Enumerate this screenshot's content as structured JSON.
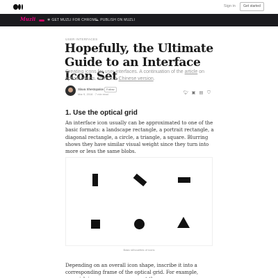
{
  "nav": {
    "logo_icon": "medium-logo-icon",
    "sign_in": "Sign in",
    "get_started": "Get started"
  },
  "banner": {
    "brand": "Muzli",
    "chrome_icon": "chrome-icon",
    "chrome_label": "GET MUZLI FOR CHROME",
    "publish_icon": "publish-icon",
    "publish_label": "PUBLISH ON MUZLI",
    "accent": "#e6007e"
  },
  "article": {
    "kicker": "USER INTERFACES",
    "title": "Hopefully, the Ultimate Guide to an Interface Icon Set",
    "subtitle_1": "Creating icons for user interfaces. A continuation of the ",
    "subtitle_link_1": "article",
    "subtitle_2": " on optical effects. Here is a ",
    "subtitle_link_2": "Chinese version",
    "subtitle_3": ".",
    "author": "Slava Shestopalov",
    "follow": "Follow",
    "meta": "Mar 9, 2018 · 7 min read",
    "share_icons": [
      "twitter-icon",
      "linkedin-icon",
      "facebook-icon",
      "bookmark-icon"
    ],
    "section_title": "1. Use the optical grid",
    "paragraph": "An interface icon usually can be approximated to one of the basic formats: a landscape rectangle, a portrait rectangle, a diagonal rectangle, a circle, a triangle, a square. Blurring shows they have similar visual weight since they turn into more or less the same blobs.",
    "figure_caption": "Basic silhouettes of icons",
    "paragraph2": "Depending on an overall icon shape, inscribe it into a corresponding frame of the optical grid. For example, squarish icons are more compact than"
  }
}
